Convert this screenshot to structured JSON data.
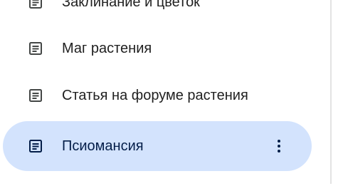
{
  "colors": {
    "active_background": "#d3e3fd",
    "active_text": "#041e49",
    "text": "#1f1f1f",
    "icon": "#444746",
    "divider": "#e3e3e3"
  },
  "nav": {
    "items": [
      {
        "label": "Заклинание и цветок",
        "icon": "document-icon",
        "active": false
      },
      {
        "label": "Маг растения",
        "icon": "document-icon",
        "active": false
      },
      {
        "label": "Статья на форуме растения",
        "icon": "document-icon",
        "active": false
      },
      {
        "label": "Псиомансия",
        "icon": "document-icon",
        "active": true,
        "more_icon": "more-vert-icon"
      }
    ]
  }
}
